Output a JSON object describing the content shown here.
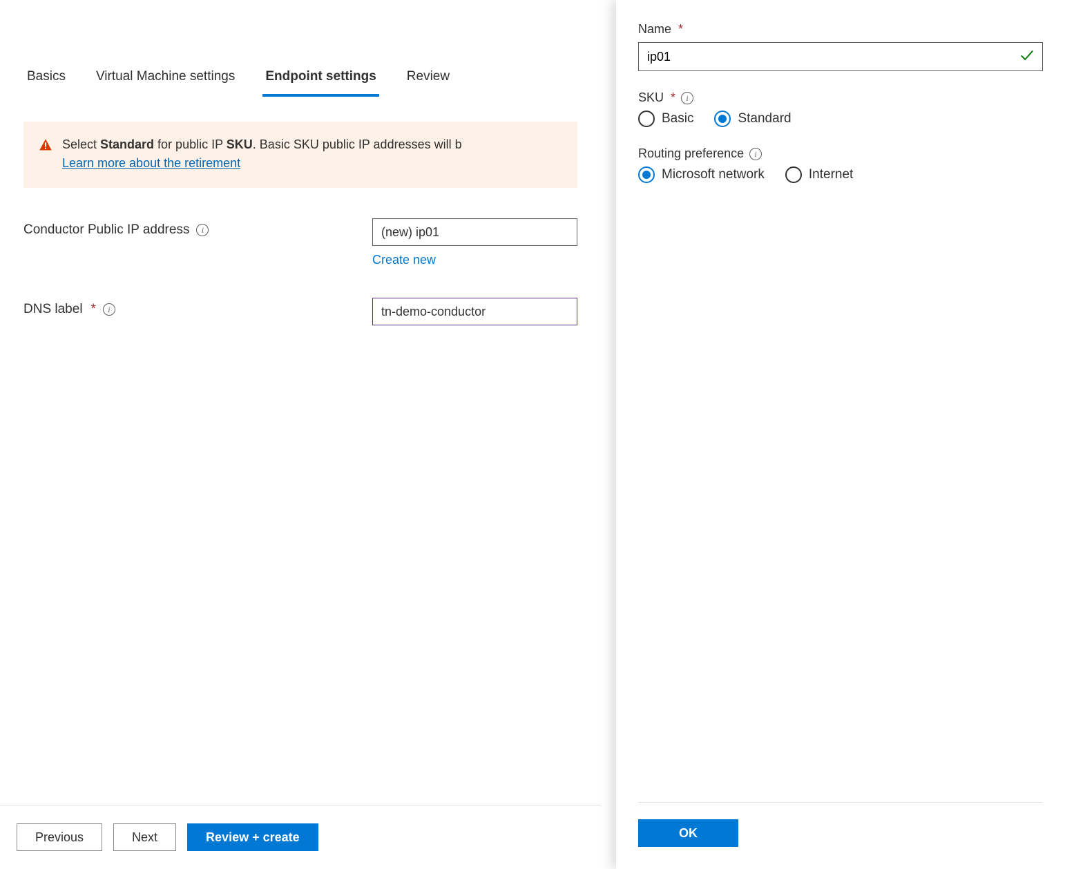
{
  "tabs": {
    "basics": "Basics",
    "vm": "Virtual Machine settings",
    "endpoint": "Endpoint settings",
    "review": "Review"
  },
  "alert": {
    "prefix": "Select ",
    "bold1": "Standard",
    "mid": " for public IP ",
    "bold2": "SKU",
    "suffix": ". Basic SKU public IP addresses will b",
    "link": "Learn more about the retirement"
  },
  "form": {
    "public_ip_label": "Conductor Public IP address",
    "public_ip_value": "(new) ip01",
    "create_new": "Create new",
    "dns_label": "DNS label",
    "dns_value": "tn-demo-conductor"
  },
  "footer": {
    "previous": "Previous",
    "next": "Next",
    "review_create": "Review + create"
  },
  "panel": {
    "name_label": "Name",
    "name_value": "ip01",
    "sku_label": "SKU",
    "sku_basic": "Basic",
    "sku_standard": "Standard",
    "routing_label": "Routing preference",
    "routing_ms": "Microsoft network",
    "routing_internet": "Internet",
    "ok": "OK"
  }
}
